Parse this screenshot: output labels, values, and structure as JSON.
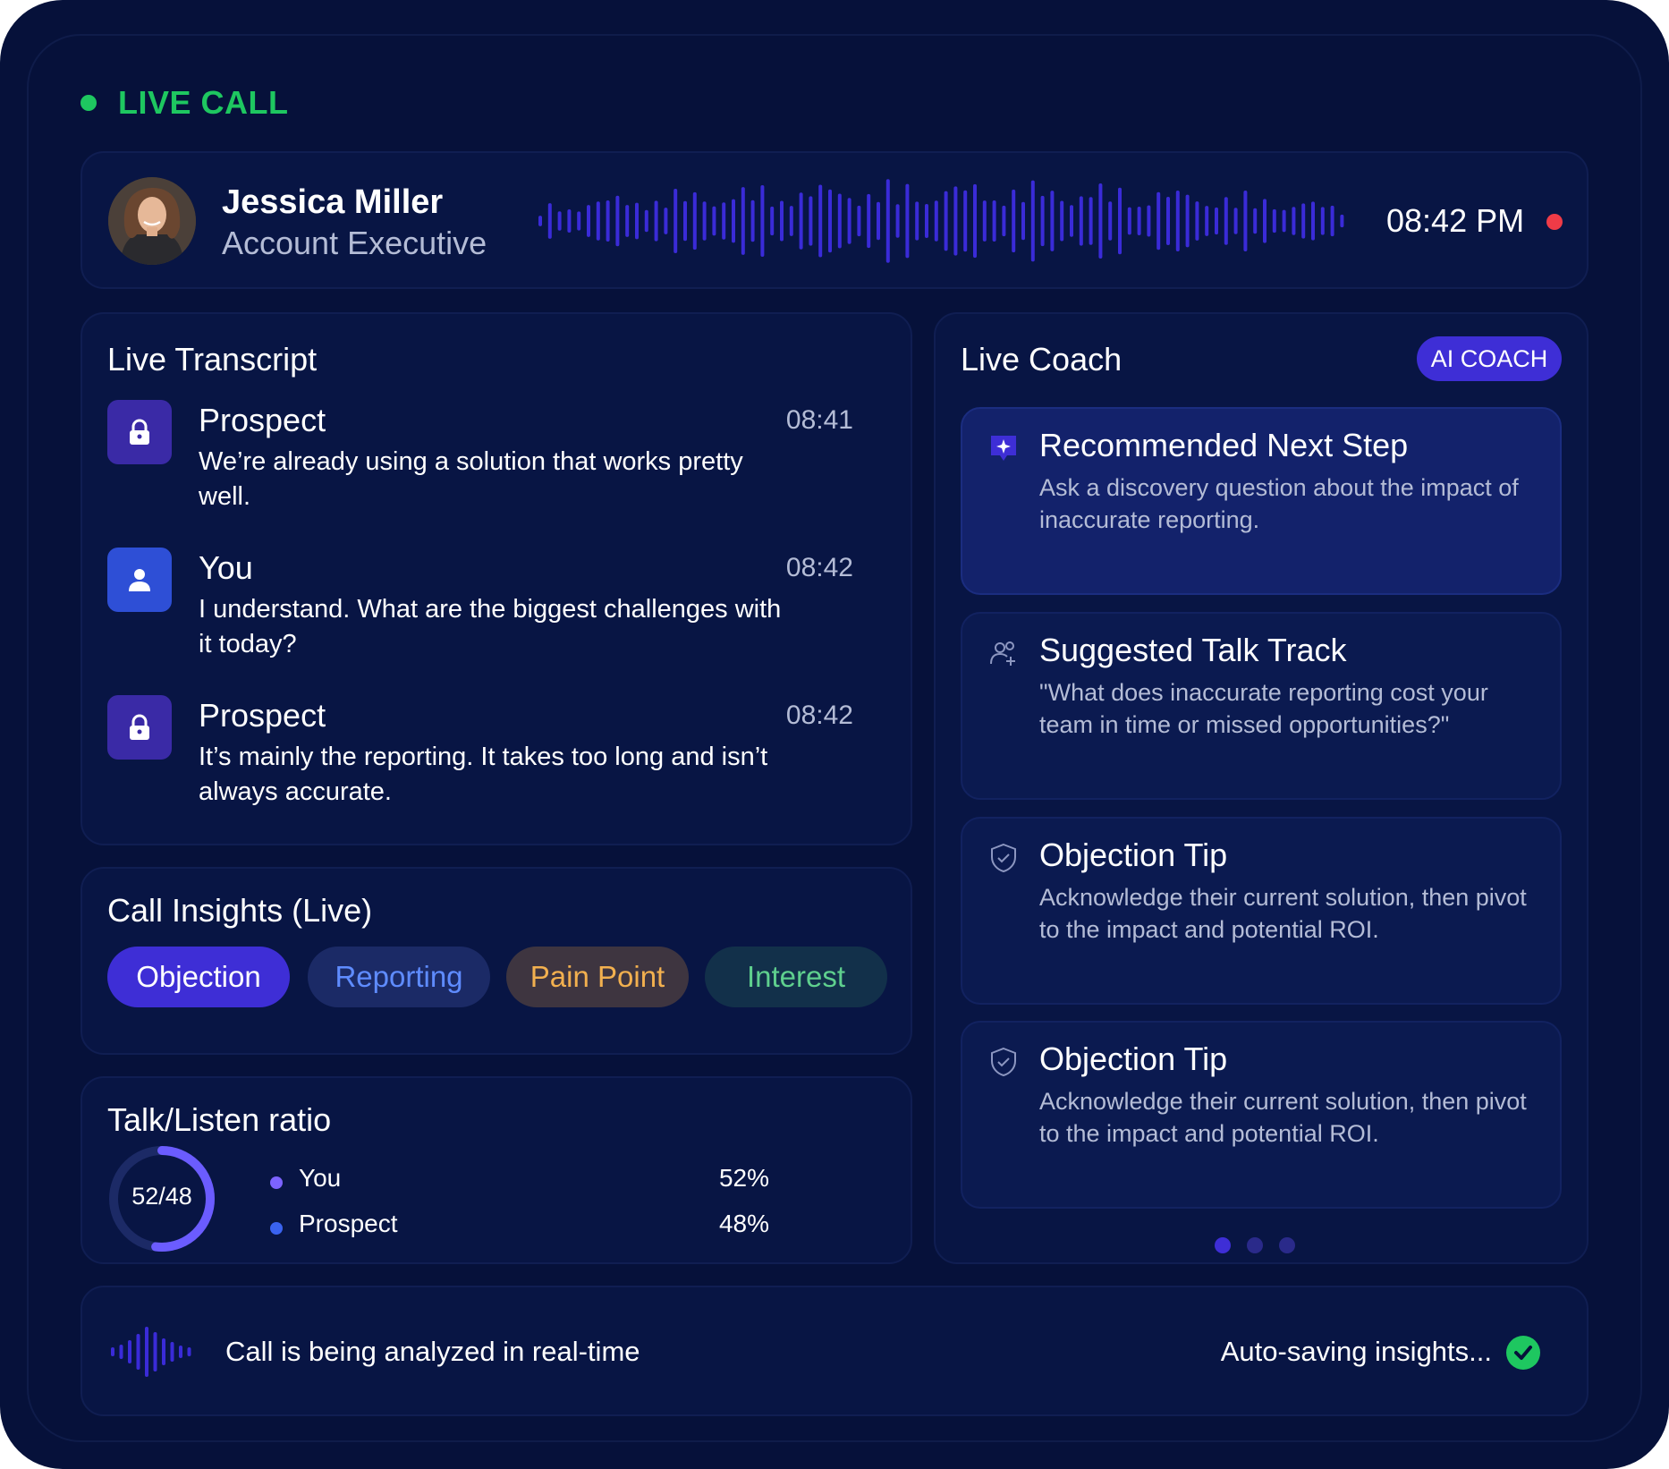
{
  "live": {
    "label": "LIVE CALL",
    "color": "#1ec760"
  },
  "caller": {
    "name": "Jessica Miller",
    "role": "Account Executive",
    "time": "08:42 PM",
    "avatar_icon": "person-photo"
  },
  "transcript": {
    "title": "Live Transcript",
    "entries": [
      {
        "speaker": "Prospect",
        "time": "08:41",
        "text": "We’re already using a solution that works pretty well.",
        "icon": "lock-icon"
      },
      {
        "speaker": "You",
        "time": "08:42",
        "text": "I understand. What are the biggest challenges with it today?",
        "icon": "user-icon"
      },
      {
        "speaker": "Prospect",
        "time": "08:42",
        "text": "It’s mainly the reporting. It takes too long and isn’t always accurate.",
        "icon": "lock-icon"
      }
    ]
  },
  "insights": {
    "title": "Call Insights (Live)",
    "chips": [
      "Objection",
      "Reporting",
      "Pain Point",
      "Interest"
    ]
  },
  "ratio": {
    "title": "Talk/Listen ratio",
    "label": "52/48",
    "you_fraction": 0.52,
    "rows": [
      {
        "name": "You",
        "value": "52%",
        "color": "#7c63ff"
      },
      {
        "name": "Prospect",
        "value": "48%",
        "color": "#3a63f0"
      }
    ]
  },
  "coach": {
    "title": "Live Coach",
    "badge": "AI COACH",
    "tips": [
      {
        "title": "Recommended Next Step",
        "body": "Ask a discovery question about the impact of inaccurate reporting.",
        "icon": "sparkle-chat-icon"
      },
      {
        "title": "Suggested Talk Track",
        "body": "\"What does inaccurate reporting cost your team in time or missed opportunities?\"",
        "icon": "users-icon"
      },
      {
        "title": "Objection Tip",
        "body": "Acknowledge their current solution, then pivot to the impact and potential ROI.",
        "icon": "shield-check-icon"
      },
      {
        "title": "Objection Tip",
        "body": "Acknowledge their current solution, then pivot to the impact and potential ROI.",
        "icon": "shield-check-icon"
      }
    ],
    "pages": 3,
    "active_page": 1
  },
  "footer": {
    "status": "Call is being analyzed in real-time",
    "saving": "Auto-saving insights...",
    "check_color": "#1ec760"
  },
  "colors": {
    "accent": "#3e2ed6",
    "background": "#06113a",
    "wave": "#3a2bd8"
  }
}
